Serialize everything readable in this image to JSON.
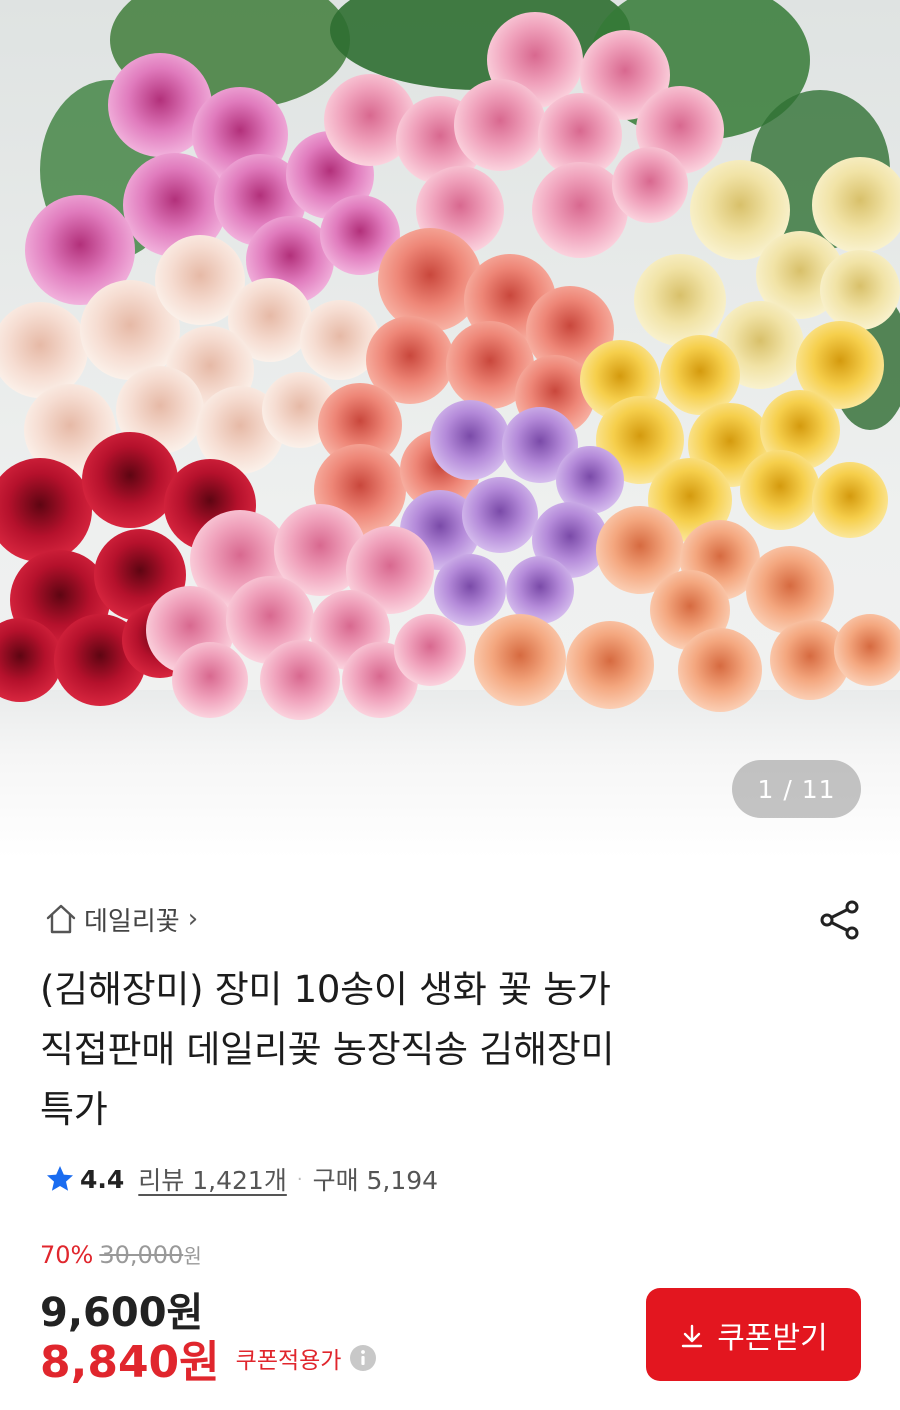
{
  "gallery": {
    "current_page": "1",
    "total_pages": "11",
    "counter_text": "1 / 11",
    "image_subject": "roses-bouquet-photo"
  },
  "breadcrumb": {
    "icon": "home-icon",
    "label": "데일리꽃",
    "chevron": "›"
  },
  "share": {
    "icon": "share-icon"
  },
  "product": {
    "title_lines": [
      "(김해장미) 장미 10송이 생화 꽃 농가",
      "직접판매 데일리꽃 농장직송 김해장미",
      "특가"
    ],
    "rating": {
      "score": "4.4",
      "review_label": "리뷰 1,421개",
      "separator": "·",
      "purchase_label": "구매 5,194",
      "star_color": "#1a6cf0"
    }
  },
  "price": {
    "discount_rate": "70%",
    "original_price": "30,000",
    "original_unit": "원",
    "sale_price": "9,600원",
    "coupon_price": "8,840원",
    "coupon_label": "쿠폰적용가",
    "accent_color": "#e0262d"
  },
  "coupon_button": {
    "label": "쿠폰받기",
    "icon": "download-icon",
    "color": "#e3161f"
  }
}
